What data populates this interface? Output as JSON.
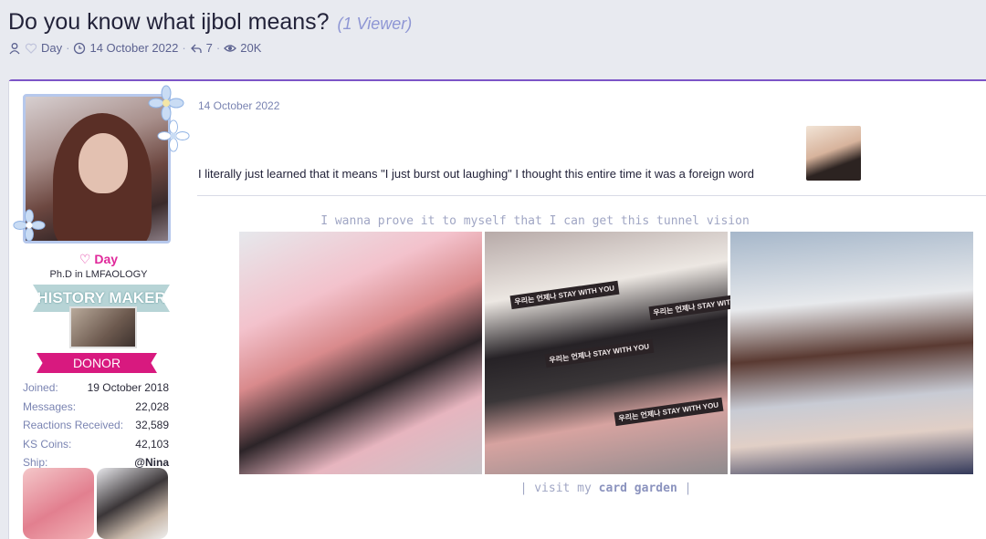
{
  "thread": {
    "title": "Do you know what ijbol means?",
    "viewers": "(1 Viewer)",
    "meta": {
      "author": "Day",
      "date": "14 October 2022",
      "replies": "7",
      "views": "20K"
    }
  },
  "sidebar": {
    "username": "Day",
    "user_title": "Ph.D in LMFAOLOGY",
    "banners": {
      "history": "HISTORY MAKER",
      "donor": "DONOR"
    },
    "stats": [
      {
        "key": "Joined:",
        "value": "19 October 2018"
      },
      {
        "key": "Messages:",
        "value": "22,028"
      },
      {
        "key": "Reactions Received:",
        "value": "32,589"
      },
      {
        "key": "KS Coins:",
        "value": "42,103"
      },
      {
        "key": "Ship:",
        "value": "@Nina"
      }
    ]
  },
  "post": {
    "date": "14 October 2022",
    "text": "I literally just learned that it means \"I just burst out laughing\" I thought this entire time it was a foreign word",
    "signature": {
      "quote": "I wanna prove it to myself that I can get this tunnel vision",
      "link_prefix": "| visit my",
      "link_text": "card garden",
      "link_suffix": "|",
      "sign_text": "우리는 언제나 STAY WITH YOU"
    }
  },
  "colors": {
    "accent": "#7c55c7",
    "username": "#e0289a",
    "donor": "#d8197f",
    "history_banner": "#b7d4d6",
    "muted": "#7a84b2"
  },
  "icons": [
    "user-icon",
    "heart-icon",
    "clock-icon",
    "reply-icon",
    "eye-icon",
    "flower-icon"
  ]
}
